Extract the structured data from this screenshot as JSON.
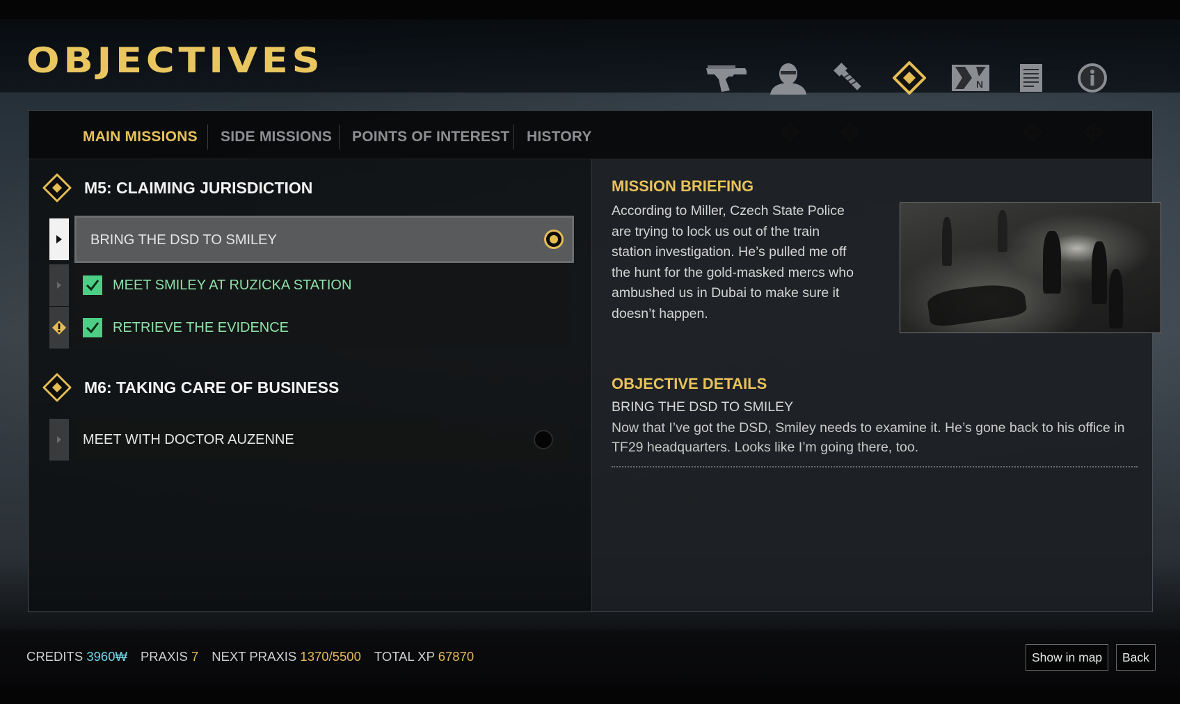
{
  "page": {
    "title": "OBJECTIVES"
  },
  "top_tabs": [
    {
      "name": "weapons-tab",
      "icon": "pistol-icon",
      "badge": ""
    },
    {
      "name": "character-tab",
      "icon": "masked-agent-icon",
      "badge": "7"
    },
    {
      "name": "crafting-tab",
      "icon": "bolt-icon",
      "badge": "5"
    },
    {
      "name": "objectives-tab",
      "icon": "objective-diamond-icon",
      "badge": ""
    },
    {
      "name": "map-tab",
      "icon": "map-icon",
      "badge": ""
    },
    {
      "name": "documents-tab",
      "icon": "document-icon",
      "badge": "9+"
    },
    {
      "name": "info-tab",
      "icon": "info-icon",
      "badge": "9+"
    }
  ],
  "subtabs": {
    "main": "MAIN MISSIONS",
    "side": "SIDE MISSIONS",
    "poi": "POINTS OF INTEREST",
    "history": "HISTORY"
  },
  "missions": [
    {
      "title": "M5: CLAIMING JURISDICTION",
      "objectives": [
        {
          "label": "BRING THE DSD TO SMILEY",
          "state": "selected-tracked"
        },
        {
          "label": "MEET SMILEY AT RUZICKA STATION",
          "state": "completed"
        },
        {
          "label": "RETRIEVE THE EVIDENCE",
          "state": "completed-warning"
        }
      ]
    },
    {
      "title": "M6: TAKING CARE OF BUSINESS",
      "objectives": [
        {
          "label": "MEET WITH DOCTOR AUZENNE",
          "state": "untracked"
        }
      ]
    }
  ],
  "briefing": {
    "heading": "MISSION BRIEFING",
    "text": "According to Miller, Czech State Police are trying to lock us out of the train station investigation. He’s pulled me off the hunt for the gold-masked mercs who ambushed us in Dubai to make sure it doesn’t happen."
  },
  "objective_details": {
    "heading": "OBJECTIVE DETAILS",
    "title": "BRING THE DSD TO SMILEY",
    "text": "Now that I’ve got the DSD, Smiley needs to examine it. He’s gone back to his office in TF29 headquarters. Looks like I’m going there, too."
  },
  "footer": {
    "credits_label": "CREDITS",
    "credits_value": "3960₩",
    "praxis_label": "PRAXIS",
    "praxis_value": "7",
    "next_praxis_label": "NEXT PRAXIS",
    "next_praxis_value": "1370/5500",
    "total_xp_label": "TOTAL XP",
    "total_xp_value": "67870",
    "show_in_map": "Show in map",
    "back": "Back"
  },
  "colors": {
    "accent_gold": "#e8c25a",
    "completed_green": "#4ccf84",
    "credits_cyan": "#6fd7e8"
  }
}
